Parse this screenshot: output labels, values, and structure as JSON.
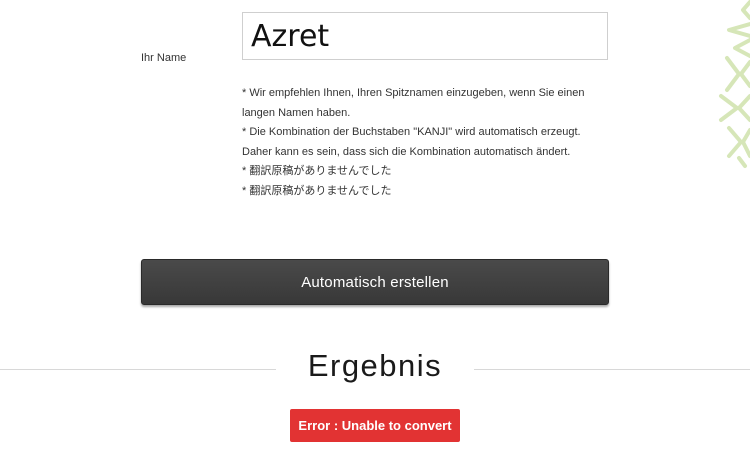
{
  "form": {
    "name_label": "Ihr Name",
    "name_value": "Azret"
  },
  "notes": [
    "* Wir empfehlen Ihnen, Ihren Spitznamen einzugeben, wenn Sie einen langen Namen haben.",
    "* Die Kombination der Buchstaben \"KANJI\" wird automatisch erzeugt.",
    "Daher kann es sein, dass sich die Kombination automatisch ändert.",
    "* 翻訳原稿がありませんでした",
    "* 翻訳原稿がありませんでした"
  ],
  "actions": {
    "generate_label": "Automatisch erstellen"
  },
  "result": {
    "heading": "Ergebnis",
    "error_message": "Error : Unable to convert"
  },
  "colors": {
    "button_bg": "#3d3d3d",
    "error_bg": "#e23333",
    "ornament": "#d6e6b8"
  }
}
